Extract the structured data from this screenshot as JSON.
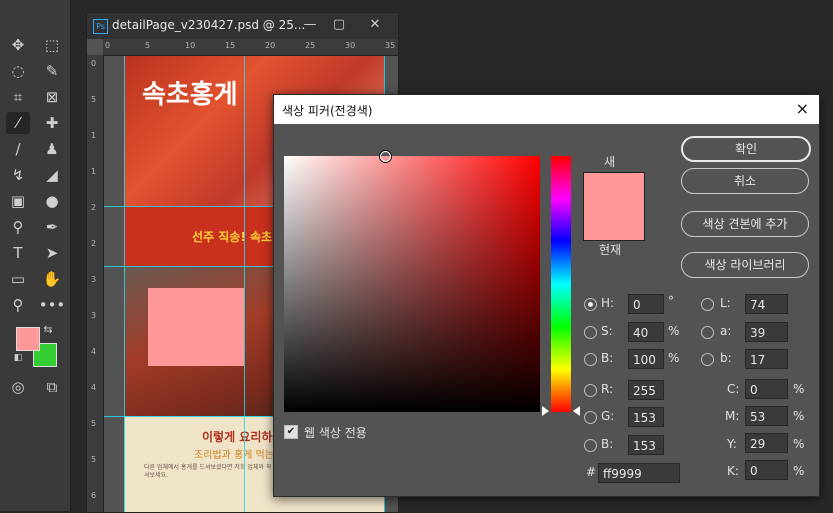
{
  "document": {
    "title": "detailPage_v230427.psd @ 25...",
    "ruler_top_ticks": [
      "0",
      "5",
      "10",
      "15",
      "20",
      "25",
      "30",
      "35"
    ],
    "ruler_left_ticks": [
      "0",
      "5",
      "1",
      "1",
      "2",
      "2",
      "3",
      "3",
      "4",
      "4",
      "5",
      "5",
      "6"
    ],
    "banner_title": "속초홍게",
    "red_band_text": "선주 직송! 속초",
    "cream_heading": "이렇게 요리하세요",
    "cream_sub": "조리법과 홍게 먹는 방법을 알려드립니다",
    "cream_para": "다른 업체에서 홍게를 드셔보셨다면 저희 업체와 꼭 비교해보세요. 속초 앞바다 홍게 드셔보세요."
  },
  "toolbar": {
    "foreground_color": "#ff9999",
    "background_color": "#33cc33"
  },
  "color_picker": {
    "title": "색상 피커(전경색)",
    "close_icon": "×",
    "new_label": "새",
    "current_label": "현재",
    "new_color": "#ff9999",
    "current_color": "#ff9999",
    "buttons": {
      "ok": "확인",
      "cancel": "취소",
      "add_to_swatches": "색상 견본에 추가",
      "color_libraries": "색상 라이브러리"
    },
    "hsb": {
      "h_label": "H:",
      "h_value": "0",
      "h_unit": "°",
      "s_label": "S:",
      "s_value": "40",
      "s_unit": "%",
      "b_label": "B:",
      "b_value": "100",
      "b_unit": "%"
    },
    "rgb": {
      "r_label": "R:",
      "r_value": "255",
      "g_label": "G:",
      "g_value": "153",
      "b_label": "B:",
      "b_value": "153"
    },
    "lab": {
      "l_label": "L:",
      "l_value": "74",
      "a_label": "a:",
      "a_value": "39",
      "b_label": "b:",
      "b_value": "17"
    },
    "cmyk": {
      "c_label": "C:",
      "c_value": "0",
      "c_unit": "%",
      "m_label": "M:",
      "m_value": "53",
      "m_unit": "%",
      "y_label": "Y:",
      "y_value": "29",
      "y_unit": "%",
      "k_label": "K:",
      "k_value": "0",
      "k_unit": "%"
    },
    "hex_label": "#",
    "hex_value": "ff9999",
    "web_colors_label": "웹 색상 전용",
    "web_colors_checked": true,
    "selected_mode": "H"
  }
}
